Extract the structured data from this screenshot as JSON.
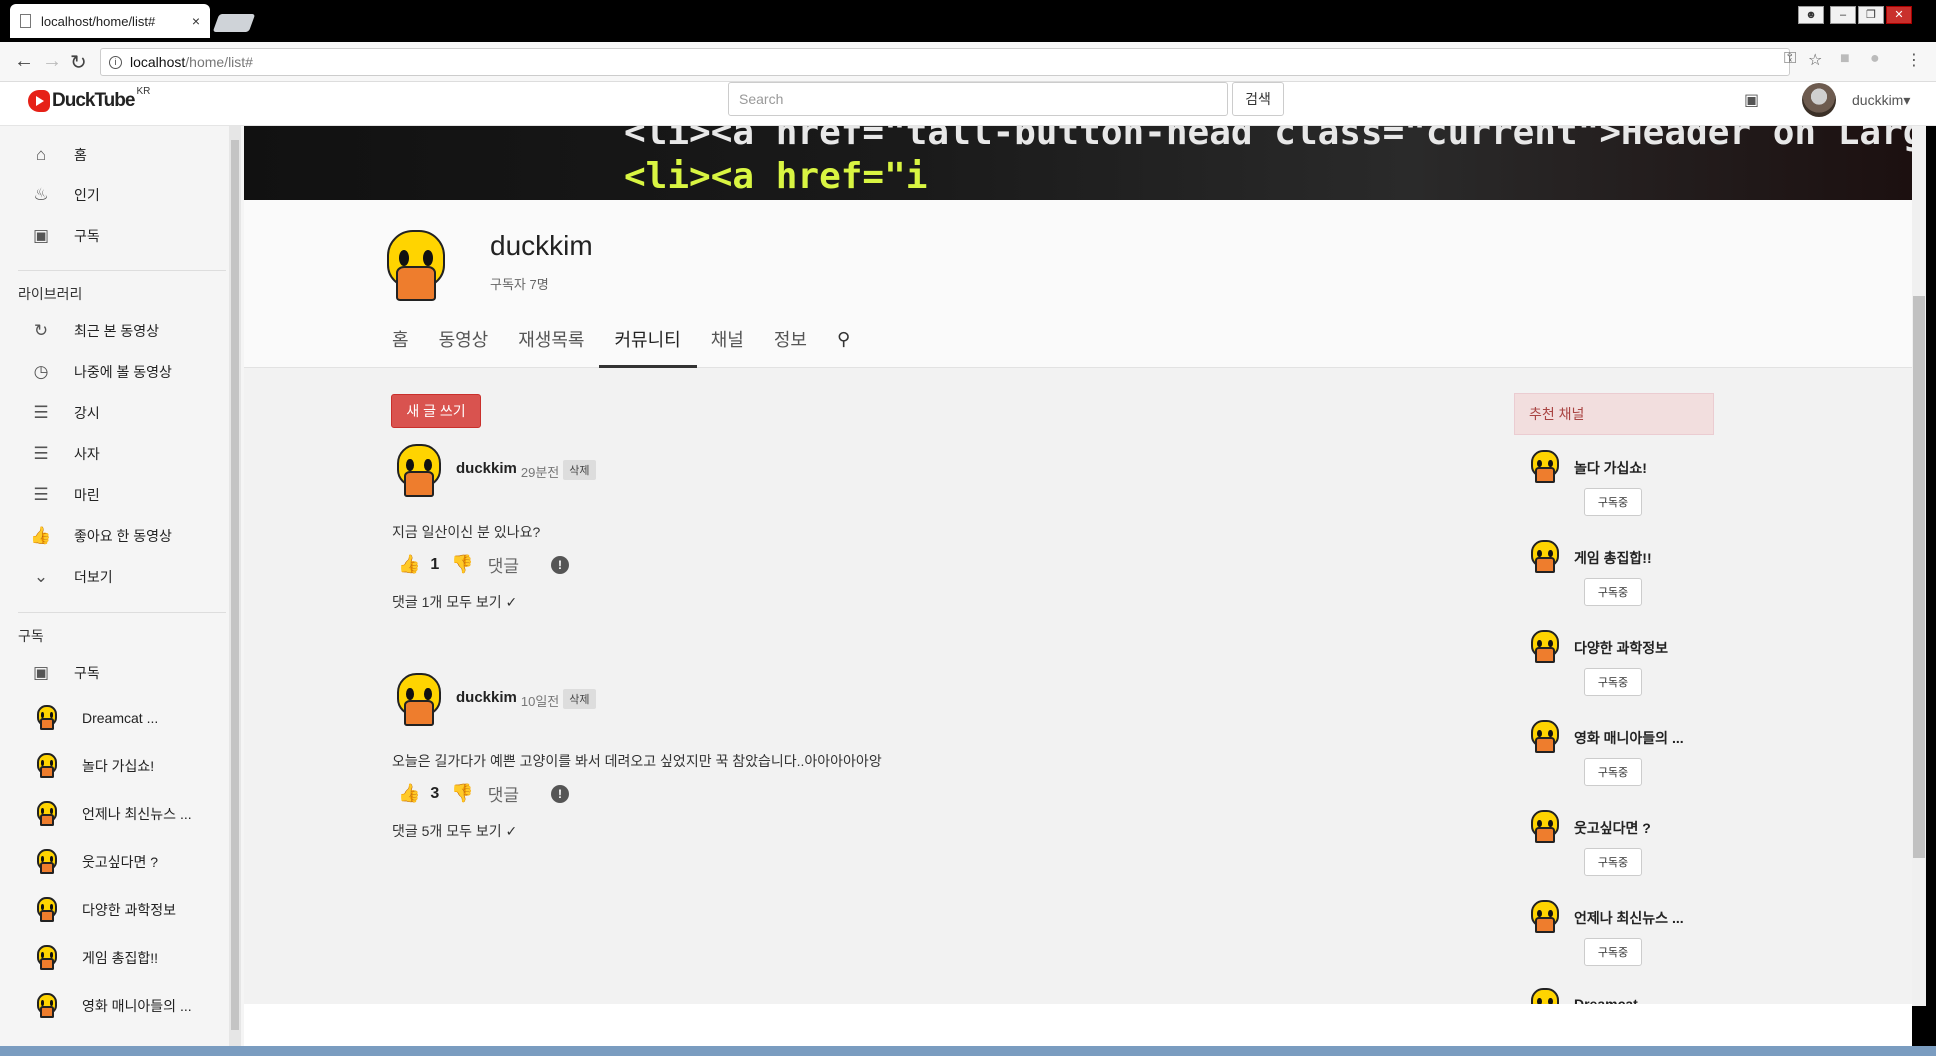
{
  "browser": {
    "tab_title": "localhost/home/list#",
    "tab_close": "×",
    "url_host": "localhost",
    "url_path": "/home/list#"
  },
  "header": {
    "logo_name": "DuckTube",
    "logo_region": "KR",
    "search_placeholder": "Search",
    "search_button": "검색",
    "username": "duckkim▾"
  },
  "sidebar": {
    "top_items": [
      {
        "label": "홈",
        "icon": "home-icon"
      },
      {
        "label": "인기",
        "icon": "fire-icon"
      },
      {
        "label": "구독",
        "icon": "inbox-icon"
      }
    ],
    "library_title": "라이브러리",
    "library_items": [
      {
        "label": "최근 본 동영상",
        "icon": "history-icon"
      },
      {
        "label": "나중에 볼 동영상",
        "icon": "clock-icon"
      },
      {
        "label": "강시",
        "icon": "list-icon"
      },
      {
        "label": "사자",
        "icon": "list-icon"
      },
      {
        "label": "마린",
        "icon": "list-icon"
      },
      {
        "label": "좋아요 한 동영상",
        "icon": "thumbs-up-icon"
      },
      {
        "label": "더보기",
        "icon": "chevron-down-icon"
      }
    ],
    "subs_title": "구독",
    "subs_header": "구독",
    "subs_channels": [
      "Dreamcat ...",
      "놀다 가십쇼!",
      "언제나 최신뉴스 ...",
      "웃고싶다면 ?",
      "다양한 과학정보",
      "게임 총집합!!",
      "영화 매니아들의 ..."
    ]
  },
  "channel": {
    "name": "duckkim",
    "subscribers": "구독자 7명",
    "tabs": [
      "홈",
      "동영상",
      "재생목록",
      "커뮤니티",
      "채널",
      "정보"
    ],
    "active_tab": "커뮤니티",
    "banner_line1": "<li><a href=\"tall-button-head class=\"current\">Header on Larger Viewports",
    "banner_line2": "<li><a href=\"i",
    "new_post_button": "새 글 쓰기"
  },
  "posts": [
    {
      "author": "duckkim",
      "time": "29분전",
      "delete_label": "삭제",
      "text": "지금 일산이신 분 있나요?",
      "likes": "1",
      "comment_label": "댓글",
      "view_comments": "댓글 1개 모두 보기"
    },
    {
      "author": "duckkim",
      "time": "10일전",
      "delete_label": "삭제",
      "text": "오늘은 길가다가 예쁜 고양이를 봐서 데려오고 싶었지만 꾹 참았습니다..아아아아아앙",
      "likes": "3",
      "comment_label": "댓글",
      "view_comments": "댓글 5개 모두 보기"
    }
  ],
  "recommended": {
    "title": "추천 채널",
    "subscribe_label": "구독중",
    "channels": [
      "놀다 가십쇼!",
      "게임 총집합!!",
      "다양한 과학정보",
      "영화 매니아들의 ...",
      "웃고싶다면 ?",
      "언제나 최신뉴스 ...",
      "Dreamcat ..."
    ]
  },
  "colors": {
    "accent_red": "#d9534f",
    "rec_header_bg": "#f2dede",
    "rec_header_text": "#a94442"
  }
}
